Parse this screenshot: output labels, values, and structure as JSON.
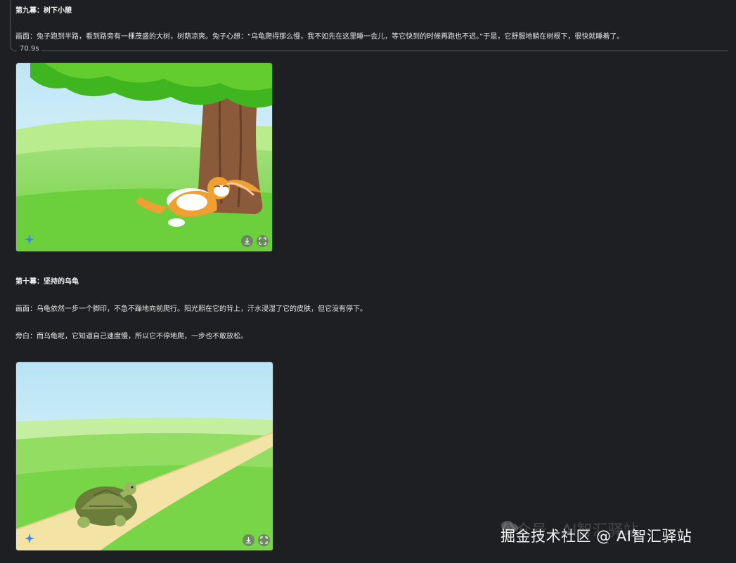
{
  "scene9": {
    "title": "第九幕：树下小憩",
    "description": "画面：兔子跑到半路，看到路旁有一棵茂盛的大树，树荫凉爽。兔子心想：“乌龟爬得那么慢，我不如先在这里睡一会儿，等它快到的时候再跑也不迟。”于是，它舒服地躺在树根下，很快就睡着了。",
    "elapsed": "70.9s"
  },
  "scene10": {
    "title": "第十幕：坚持的乌龟",
    "description": "画面：乌龟依然一步一个脚印，不急不躁地向前爬行。阳光照在它的背上，汗水浸湿了它的皮肤，但它没有停下。",
    "narration": "旁白：而乌龟呢，它知道自己速度慢，所以它不停地爬，一步也不敢放松。"
  },
  "image_controls": {
    "sparkle_icon": "sparkle-icon",
    "download_icon": "download-icon",
    "fullscreen_icon": "fullscreen-icon"
  },
  "watermark": {
    "ghost_text": "公众号 · AI智汇驿站",
    "text": "掘金技术社区 @ AI智汇驿站"
  },
  "colors": {
    "background": "#1e1f22",
    "sparkle": "#3b82f6"
  }
}
